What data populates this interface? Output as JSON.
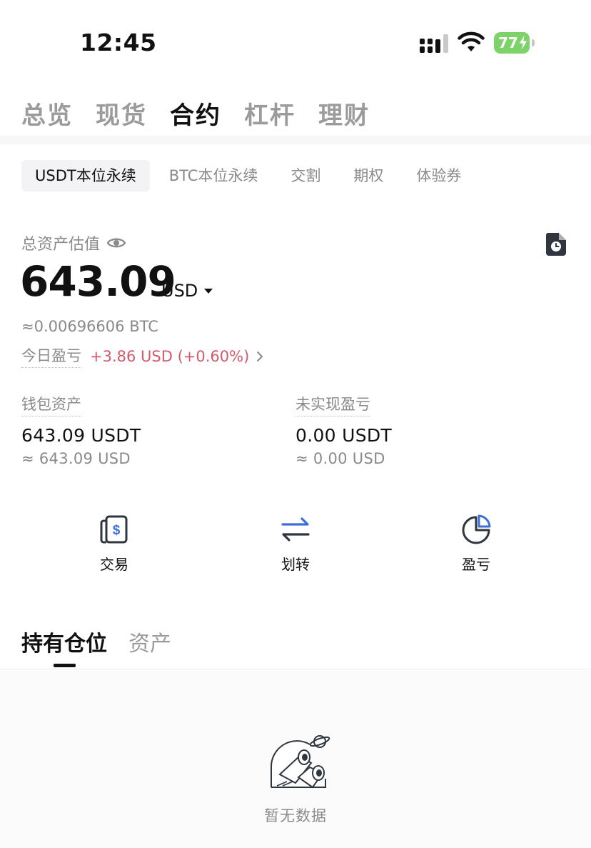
{
  "status_bar": {
    "time": "12:45",
    "battery": "77"
  },
  "top_tabs": [
    {
      "label": "总览",
      "active": false
    },
    {
      "label": "现货",
      "active": false
    },
    {
      "label": "合约",
      "active": true
    },
    {
      "label": "杠杆",
      "active": false
    },
    {
      "label": "理财",
      "active": false
    }
  ],
  "sub_tabs": [
    {
      "label": "USDT本位永续",
      "active": true
    },
    {
      "label": "BTC本位永续",
      "active": false
    },
    {
      "label": "交割",
      "active": false
    },
    {
      "label": "期权",
      "active": false
    },
    {
      "label": "体验券",
      "active": false
    }
  ],
  "summary": {
    "label": "总资产估值",
    "value": "643.09",
    "currency": "USD",
    "btc_equiv": "≈0.00696606 BTC",
    "pnl_label": "今日盈亏",
    "pnl_value": "+3.86 USD (+0.60%)"
  },
  "wallet": {
    "label": "钱包资产",
    "value": "643.09 USDT",
    "sub": "≈ 643.09 USD"
  },
  "unrealized": {
    "label": "未实现盈亏",
    "value": "0.00 USDT",
    "sub": "≈ 0.00 USD"
  },
  "actions": [
    {
      "label": "交易",
      "icon": "trade-icon"
    },
    {
      "label": "划转",
      "icon": "transfer-icon"
    },
    {
      "label": "盈亏",
      "icon": "pnl-chart-icon"
    }
  ],
  "holdings_tabs": [
    {
      "label": "持有仓位",
      "active": true
    },
    {
      "label": "资产",
      "active": false
    }
  ],
  "empty_state": {
    "text": "暂无数据",
    "icon": "binoculars-icon"
  },
  "colors": {
    "accent": "#3d6fd6",
    "loss_profit": "#d25a6b",
    "battery": "#7dd36a"
  }
}
